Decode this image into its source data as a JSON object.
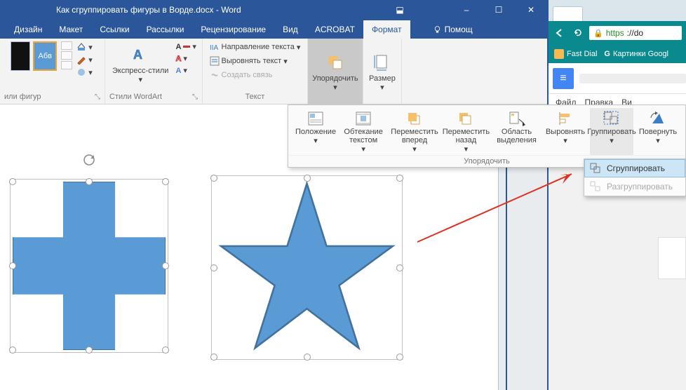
{
  "titlebar": {
    "title": "Как сгруппировать фигуры в Ворде.docx - Word",
    "minimize": "–",
    "maximize": "☐",
    "close": "✕",
    "ribbon_toggle": "⬓"
  },
  "tabs": {
    "design": "Дизайн",
    "layout": "Макет",
    "references": "Ссылки",
    "mailings": "Рассылки",
    "review": "Рецензирование",
    "view": "Вид",
    "acrobat": "ACROBAT",
    "format": "Формат",
    "help": "Помощ"
  },
  "ribbon": {
    "shape_sample": "Абв",
    "shape_styles_label": "или фигур",
    "express_styles": "Экспресс-стили",
    "wordart_label": "Стили WordArt",
    "text_direction": "Направление текста",
    "align_text": "Выровнять текст",
    "create_link": "Создать связь",
    "text_label": "Текст",
    "arrange_btn": "Упорядочить",
    "size_btn": "Размер"
  },
  "arrange": {
    "position": "Положение",
    "wrap": "Обтекание текстом",
    "bring_fwd": "Переместить вперед",
    "send_back": "Переместить назад",
    "selection_pane": "Область выделения",
    "align": "Выровнять",
    "group": "Группировать",
    "rotate": "Повернуть",
    "footer": "Упорядочить"
  },
  "group_menu": {
    "group": "Сгруппировать",
    "ungroup": "Разгруппировать"
  },
  "browser": {
    "url_scheme": "https",
    "url_rest": "://do",
    "fast_dial": "Fast Dial",
    "google_images": "Картинки Googl",
    "gdocs_file": "Файл",
    "gdocs_edit": "Правка",
    "gdocs_view": "Ви"
  }
}
